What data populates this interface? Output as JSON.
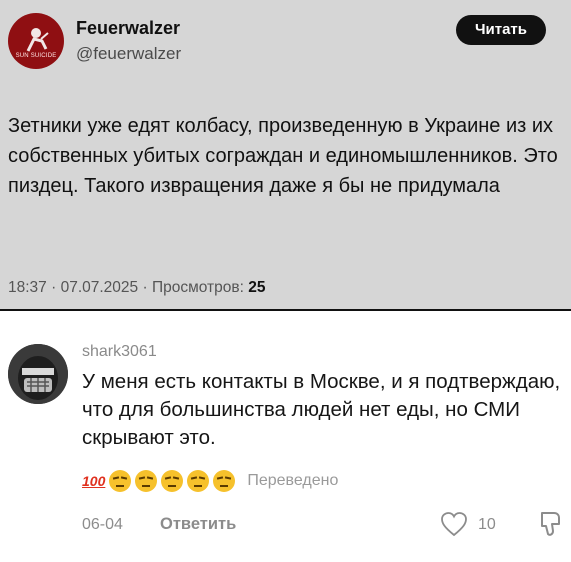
{
  "tweet": {
    "avatar_label": "SUN SUICIDE",
    "display_name": "Feuerwalzer",
    "handle": "@feuerwalzer",
    "read_button": "Читать",
    "text": "Зетники уже едят колбасу, произведенную в Украине из их собственных убитых сограждан и единомышленников. Это пиздец. Такого извращения даже я бы не придумала",
    "meta": {
      "time": "18:37",
      "date": "07.07.2025",
      "views_label": "Просмотров:",
      "views": "25"
    }
  },
  "comment": {
    "username": "shark3061",
    "text": "У меня есть контакты в Москве, и я подтверждаю, что для большинства людей нет еды, но СМИ скрывают это.",
    "emoji_hundred": "100",
    "emojis": [
      "unamused-face",
      "unamused-face",
      "unamused-face",
      "unamused-face",
      "unamused-face"
    ],
    "translated_label": "Переведено",
    "date": "06-04",
    "reply_label": "Ответить",
    "likes": "10"
  }
}
